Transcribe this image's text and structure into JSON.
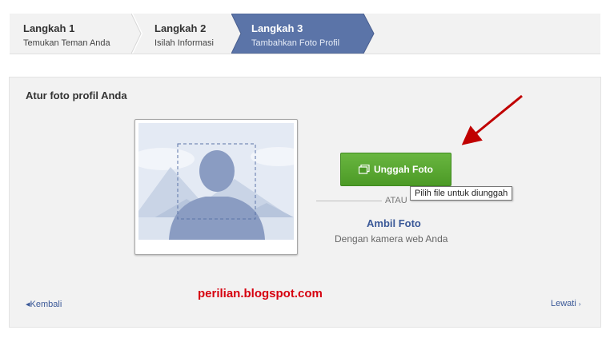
{
  "steps": [
    {
      "title": "Langkah 1",
      "subtitle": "Temukan Teman Anda"
    },
    {
      "title": "Langkah 2",
      "subtitle": "Isilah Informasi"
    },
    {
      "title": "Langkah 3",
      "subtitle": "Tambahkan Foto Profil"
    }
  ],
  "panel": {
    "title": "Atur foto profil Anda",
    "upload_button": "Unggah Foto",
    "tooltip": "Pilih file untuk diunggah",
    "or_label": "ATAU",
    "take_photo": "Ambil Foto",
    "webcam_caption": "Dengan kamera web Anda",
    "back_label": "Kembali",
    "skip_label": "Lewati"
  },
  "watermark": "perilian.blogspot.com",
  "colors": {
    "active_step": "#5b74a8",
    "button_green": "#5aa833",
    "link_blue": "#3b5998",
    "annotation_red": "#c00000"
  },
  "icons": {
    "upload": "photos-icon",
    "back": "chevron-left-icon",
    "skip": "chevron-right-icon"
  }
}
